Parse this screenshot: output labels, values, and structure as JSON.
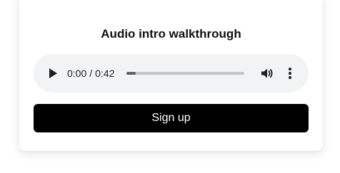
{
  "card": {
    "title": "Audio intro walkthrough"
  },
  "player": {
    "current_time": "0:00",
    "separator": "/",
    "duration": "0:42",
    "progress_fraction": 0.08,
    "play_icon": "play-icon",
    "volume_icon": "volume-icon",
    "more_icon": "more-vertical-icon"
  },
  "actions": {
    "signup_label": "Sign up"
  },
  "colors": {
    "button_bg": "#000000",
    "button_text": "#ffffff",
    "player_bg": "#f1f3f4"
  }
}
